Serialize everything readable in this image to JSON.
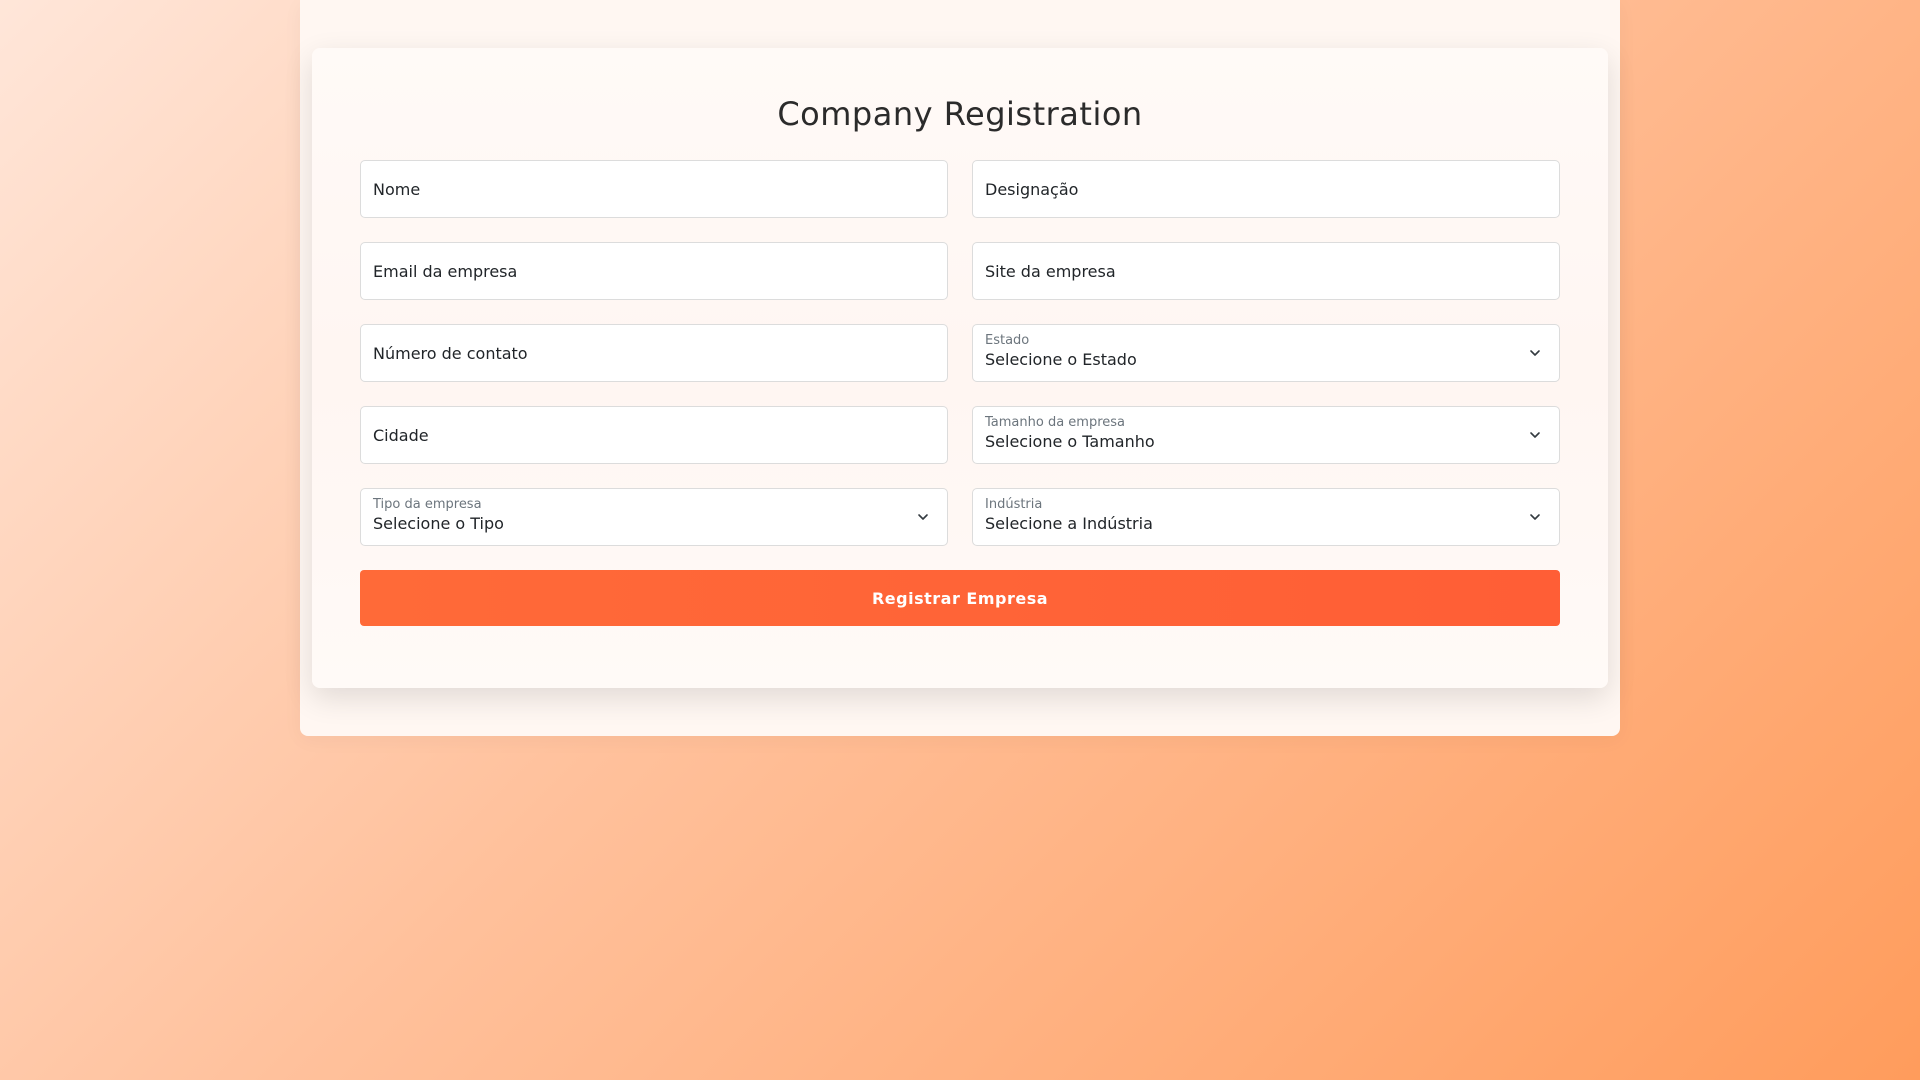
{
  "form": {
    "title": "Company Registration",
    "fields": {
      "nome": {
        "placeholder": "Nome"
      },
      "designacao": {
        "placeholder": "Designação"
      },
      "email": {
        "placeholder": "Email da empresa"
      },
      "site": {
        "placeholder": "Site da empresa"
      },
      "contato": {
        "placeholder": "Número de contato"
      },
      "estado": {
        "label": "Estado",
        "value": "Selecione o Estado"
      },
      "cidade": {
        "placeholder": "Cidade"
      },
      "tamanho": {
        "label": "Tamanho da empresa",
        "value": "Selecione o Tamanho"
      },
      "tipo": {
        "label": "Tipo da empresa",
        "value": "Selecione o Tipo"
      },
      "industria": {
        "label": "Indústria",
        "value": "Selecione a Indústria"
      }
    },
    "submit_label": "Registrar Empresa"
  },
  "colors": {
    "accent": "#ff6437",
    "background_start": "#ffe6d9",
    "background_end": "#ff9c5c"
  },
  "icons": {
    "select_chevron": "chevron-down-icon"
  }
}
